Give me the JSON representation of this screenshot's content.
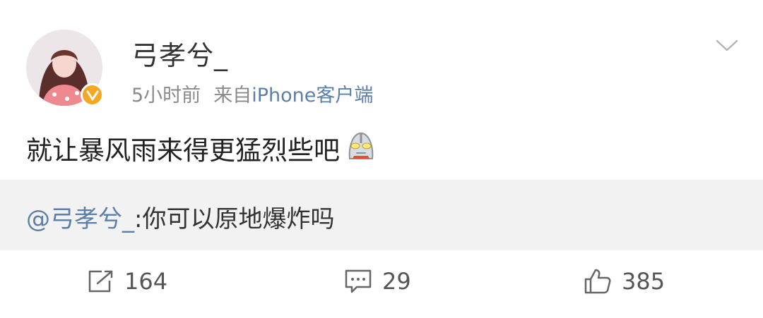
{
  "post": {
    "username": "弓孝兮_",
    "time": "5小时前",
    "source_prefix": "来自",
    "source_app": "iPhone客户端",
    "text": "就让暴风雨来得更猛烈些吧",
    "emoji": "ultraman-emoji",
    "verified": true
  },
  "repost": {
    "mention": "@弓孝兮_",
    "text": ":你可以原地爆炸吗"
  },
  "actions": {
    "forward_count": "164",
    "comment_count": "29",
    "like_count": "385"
  },
  "colors": {
    "link": "#5c7fa8",
    "badge": "#f5a623",
    "repost_bg": "#f2f2f2"
  },
  "icons": [
    "chevron-down-icon",
    "verified-badge-icon",
    "forward-icon",
    "comment-icon",
    "like-icon",
    "ultraman-emoji"
  ]
}
